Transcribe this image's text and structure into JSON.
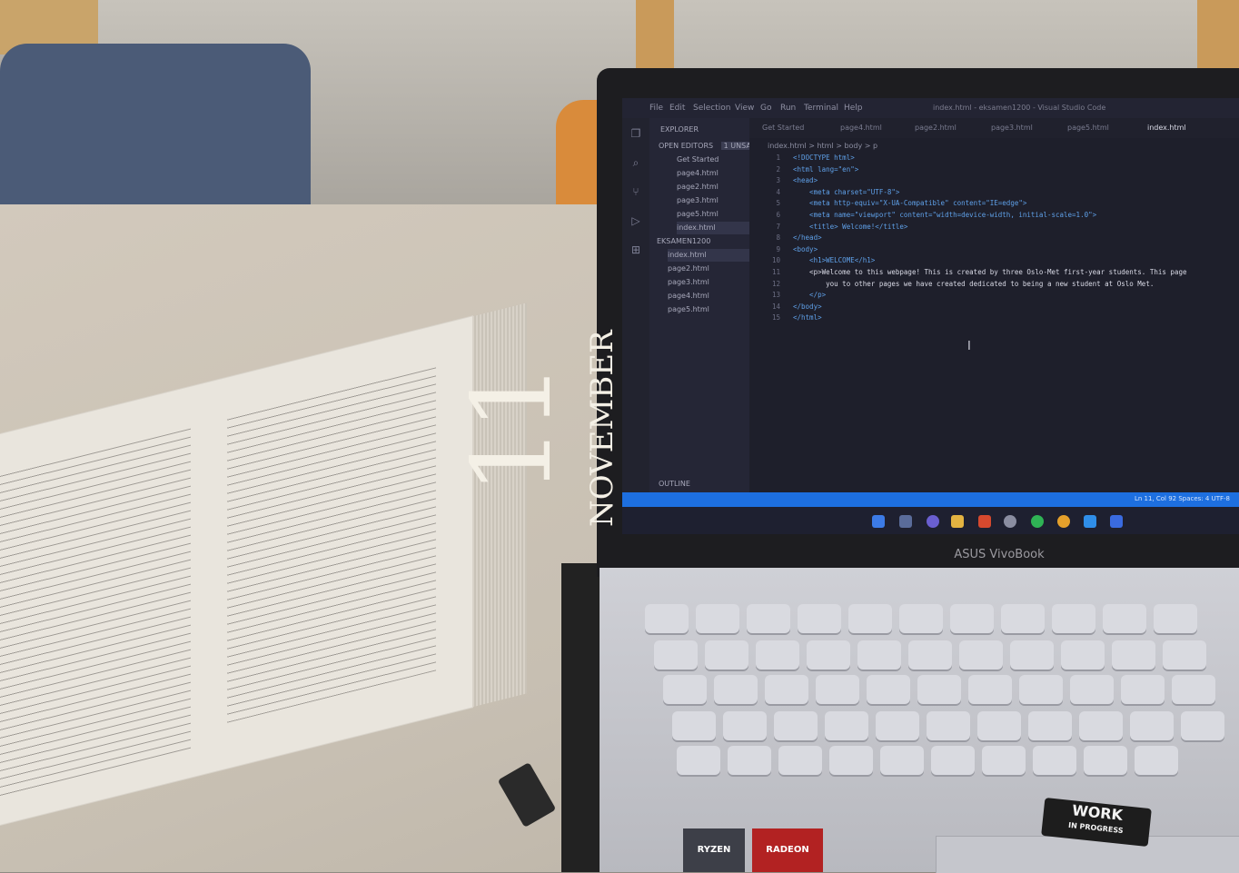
{
  "overlay": {
    "day": "11",
    "month": "NOVEMBER"
  },
  "laptop": {
    "brand": "ASUS VivoBook"
  },
  "stickers": {
    "ryzen": "RYZEN",
    "radeon": "RADEON",
    "work_line1": "WORK",
    "work_line2": "IN PROGRESS"
  },
  "vscode": {
    "menu": [
      "File",
      "Edit",
      "Selection",
      "View",
      "Go",
      "Run",
      "Terminal",
      "Help"
    ],
    "title": "index.html - eksamen1200 - Visual Studio Code",
    "explorer": "EXPLORER",
    "open_editors": "OPEN EDITORS",
    "unsaved": "1 UNSAVED",
    "open_files": [
      "Get Started",
      "page4.html",
      "page2.html",
      "page3.html",
      "page5.html",
      "index.html"
    ],
    "project": "EKSAMEN1200",
    "project_files": [
      "index.html",
      "page2.html",
      "page3.html",
      "page4.html",
      "page5.html"
    ],
    "outline": "OUTLINE",
    "tabs": [
      "Get Started",
      "page4.html",
      "page2.html",
      "page3.html",
      "page5.html",
      "index.html"
    ],
    "breadcrumb": "index.html > html > body > p",
    "code": [
      {
        "n": "1",
        "t": "<!DOCTYPE html>"
      },
      {
        "n": "2",
        "t": "<html lang=\"en\">"
      },
      {
        "n": "3",
        "t": "<head>"
      },
      {
        "n": "4",
        "t": "    <meta charset=\"UTF-8\">"
      },
      {
        "n": "5",
        "t": "    <meta http-equiv=\"X-UA-Compatible\" content=\"IE=edge\">"
      },
      {
        "n": "6",
        "t": "    <meta name=\"viewport\" content=\"width=device-width, initial-scale=1.0\">"
      },
      {
        "n": "7",
        "t": "    <title> Welcome!</title>"
      },
      {
        "n": "8",
        "t": "</head>"
      },
      {
        "n": "9",
        "t": "<body>"
      },
      {
        "n": "10",
        "t": "    <h1>WELCOME</h1>"
      },
      {
        "n": "11",
        "t": "    <p>Welcome to this webpage! This is created by three Oslo-Met first-year students. This page"
      },
      {
        "n": "12",
        "t": "        you to other pages we have created dedicated to being a new student at Oslo Met."
      },
      {
        "n": "13",
        "t": "    </p>"
      },
      {
        "n": "14",
        "t": "</body>"
      },
      {
        "n": "15",
        "t": "</html>"
      }
    ],
    "status_right": "Ln 11, Col 92    Spaces: 4    UTF-8"
  }
}
